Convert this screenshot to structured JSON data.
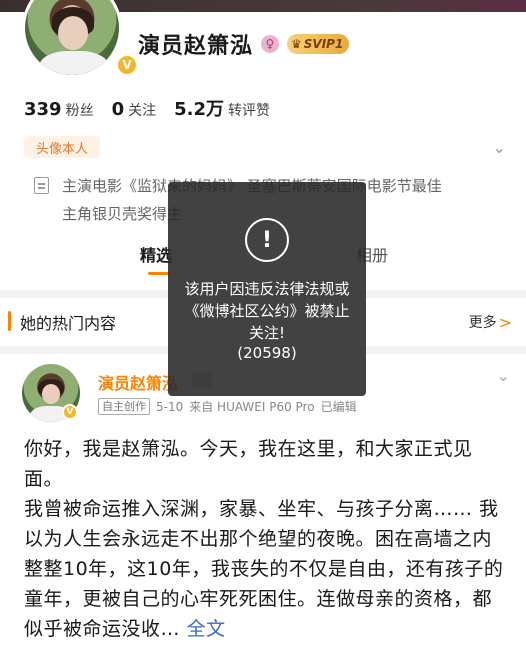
{
  "profile": {
    "name": "演员赵箫泓",
    "gender_icon": "female-symbol",
    "svip_label": "SVIP1",
    "verified_mark": "V",
    "stats": [
      {
        "value": "339",
        "label": "粉丝"
      },
      {
        "value": "0",
        "label": "关注"
      },
      {
        "value": "5.2万",
        "label": "转评赞"
      }
    ],
    "owner_tag": "头像本人",
    "bio_line1": "主演电影《监狱来的妈妈》 圣塞巴斯蒂安国际电影节最佳",
    "bio_line2": "主角银贝壳奖得主"
  },
  "tabs": [
    {
      "label": "精选"
    },
    {
      "label": "相册"
    }
  ],
  "hot_section": {
    "title": "她的热门内容",
    "more_label": "更多",
    "more_arrow": ">"
  },
  "post": {
    "author": "演员赵箫泓",
    "meta_tag": "自主创作",
    "date": "5-10",
    "source": "来自 HUAWEI P60 Pro",
    "edited": "已编辑",
    "body_line1": "你好，我是赵箫泓。今天，我在这里，和大家正式见面。",
    "body_line2": "我曾被命运推入深渊，家暴、坐牢、与孩子分离…… 我以为人生会永远走不出那个绝望的夜晚。困在高墙之内整整10年，这10年，我丧失的不仅是自由，还有孩子的童年，更被自己的心牢死死困住。连做母亲的资格，都似乎被命运没收…",
    "full_text_link": "全文"
  },
  "toast": {
    "icon": "!",
    "message": "该用户因违反法律法规或《微博社区公约》被禁止关注!",
    "code": "(20598)"
  },
  "colors": {
    "accent": "#ff8200",
    "link": "#3a6bbf",
    "verified": "#f5b728"
  },
  "icons": {
    "expand": "chevron-down-icon",
    "bio": "document-icon"
  }
}
